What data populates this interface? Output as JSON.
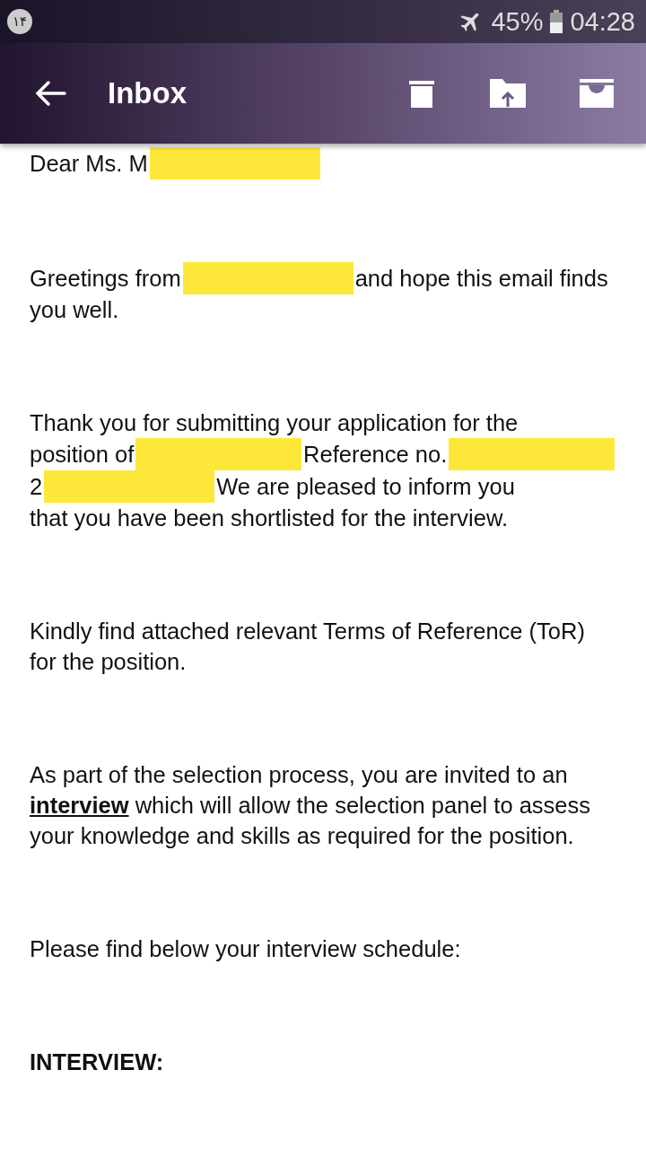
{
  "status_bar": {
    "notification": "۱۴",
    "battery": "45%",
    "time": "04:28"
  },
  "toolbar": {
    "title": "Inbox"
  },
  "message": {
    "paragraphs": [
      {
        "lines": [
          [
            {
              "kind": "text",
              "text": "Dear Ms. M"
            },
            {
              "kind": "redaction"
            }
          ]
        ]
      },
      {
        "lines": [
          [
            {
              "kind": "text",
              "text": "Greetings from"
            },
            {
              "kind": "redaction"
            },
            {
              "kind": "text",
              "text": "and hope this email finds"
            }
          ],
          [
            {
              "kind": "text",
              "text": "you well."
            }
          ]
        ]
      },
      {
        "lines": [
          [
            {
              "kind": "text",
              "text": "Thank you for submitting your application for the"
            }
          ],
          [
            {
              "kind": "text",
              "text": "position of"
            },
            {
              "kind": "redaction"
            },
            {
              "kind": "text",
              "text": "Reference no."
            },
            {
              "kind": "redaction"
            }
          ],
          [
            {
              "kind": "text",
              "text": "2"
            },
            {
              "kind": "redaction"
            },
            {
              "kind": "text",
              "text": "We are pleased to inform you"
            }
          ],
          [
            {
              "kind": "text",
              "text": "that you have been shortlisted for the interview."
            }
          ]
        ]
      },
      {
        "segments": [
          {
            "kind": "text",
            "text": "Kindly find attached relevant Terms of Reference (ToR) for the position."
          }
        ]
      },
      {
        "segments": [
          {
            "kind": "text",
            "text": "As part of the selection process, you are invited to an "
          },
          {
            "kind": "link",
            "text": "interview"
          },
          {
            "kind": "text",
            "text": " which will allow the selection panel to assess your knowledge and skills as required for the position."
          }
        ]
      },
      {
        "segments": [
          {
            "kind": "text",
            "text": "Please find below your interview schedule:"
          }
        ]
      },
      {
        "segments": [
          {
            "kind": "heading",
            "text": "INTERVIEW:"
          }
        ]
      }
    ]
  }
}
